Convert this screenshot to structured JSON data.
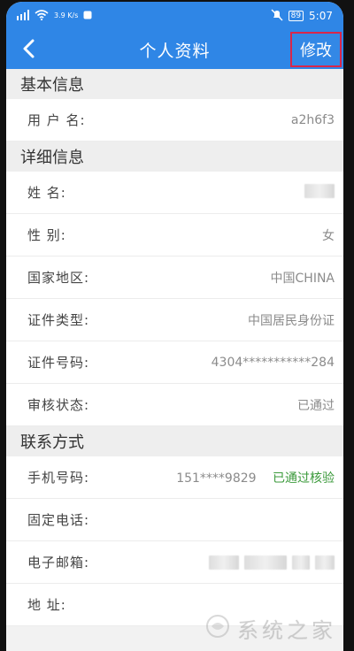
{
  "status_bar": {
    "network_speed": "3.9\nK/s",
    "battery": "89",
    "time": "5:07"
  },
  "nav": {
    "title": "个人资料",
    "edit_label": "修改"
  },
  "sections": {
    "basic": {
      "title": "基本信息",
      "rows": [
        {
          "label": "用 户 名:",
          "value": "a2h6f3"
        }
      ]
    },
    "detail": {
      "title": "详细信息",
      "rows": [
        {
          "label": "姓    名:",
          "value": ""
        },
        {
          "label": "性    别:",
          "value": "女"
        },
        {
          "label": "国家地区:",
          "value": "中国CHINA"
        },
        {
          "label": "证件类型:",
          "value": "中国居民身份证"
        },
        {
          "label": "证件号码:",
          "value": "4304***********284"
        },
        {
          "label": "审核状态:",
          "value": "已通过"
        }
      ]
    },
    "contact": {
      "title": "联系方式",
      "rows": [
        {
          "label": "手机号码:",
          "value": "151****9829",
          "extra": "已通过核验"
        },
        {
          "label": "固定电话:",
          "value": ""
        },
        {
          "label": "电子邮箱:",
          "value": ""
        },
        {
          "label": "地    址:",
          "value": ""
        }
      ]
    }
  },
  "watermark": {
    "text": "系统之家"
  },
  "icons": {
    "back": "chevron-left-icon",
    "wifi": "wifi-icon",
    "signal": "signal-icon",
    "notification": "notification-icon",
    "mute": "mute-icon"
  },
  "colors": {
    "brand_blue": "#2f86e6",
    "success_green": "#3b9a3b",
    "highlight_red": "#d9264a"
  }
}
